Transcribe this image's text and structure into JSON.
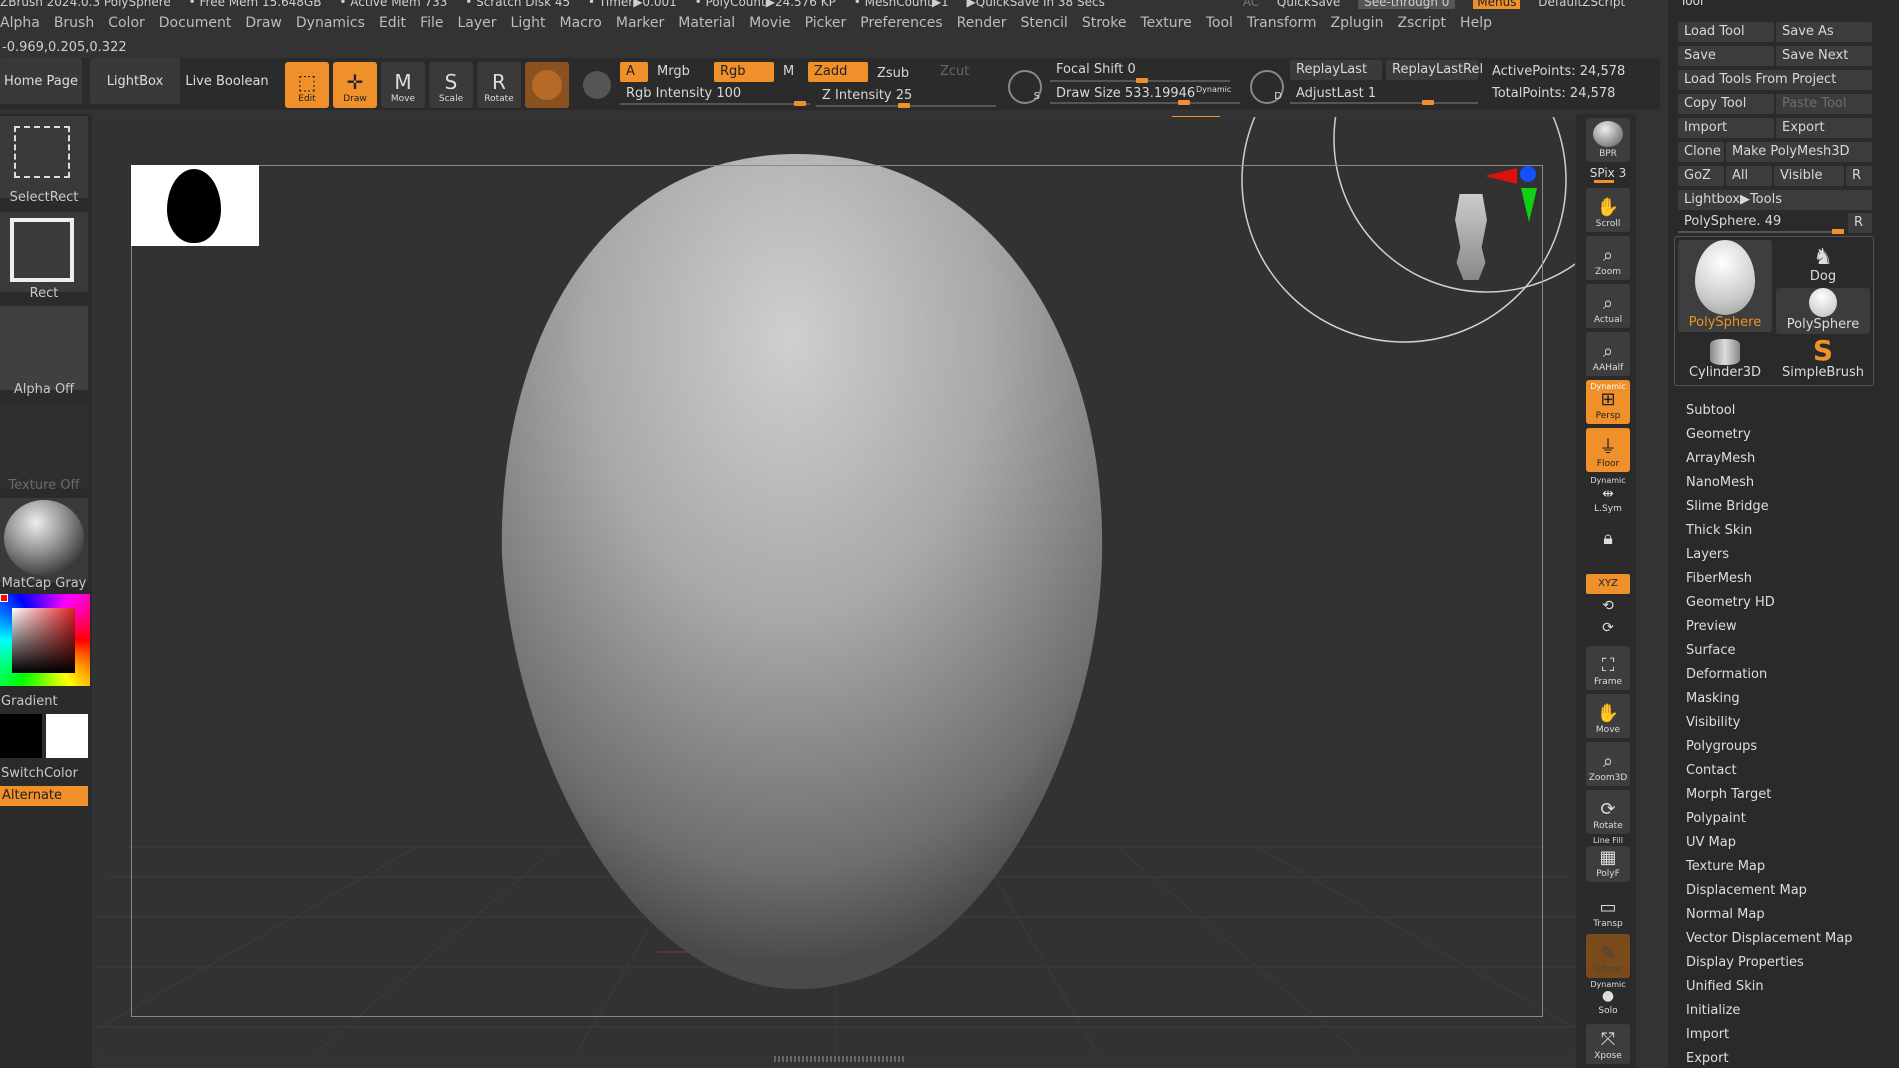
{
  "title_bar": {
    "app": "ZBrush 2024.0.3 PolySphere",
    "free_mem": "• Free Mem 15.648GB",
    "active_mem": "• Active Mem 733",
    "scratch": "• Scratch Disk 45",
    "timer": "• Timer▶0.001",
    "polycount": "• PolyCount▶24.576 KP",
    "meshcount": "• MeshCount▶1",
    "quicksave": "▶QuickSave In 38 Secs",
    "ac": "AC",
    "quicksave_btn": "QuickSave",
    "seethrough": "See-through 0",
    "menus": "Menus",
    "script": "DefaultZScript"
  },
  "menubar": [
    "Alpha",
    "Brush",
    "Color",
    "Document",
    "Draw",
    "Dynamics",
    "Edit",
    "File",
    "Layer",
    "Light",
    "Macro",
    "Marker",
    "Material",
    "Movie",
    "Picker",
    "Preferences",
    "Render",
    "Stencil",
    "Stroke",
    "Texture",
    "Tool",
    "Transform",
    "Zplugin",
    "Zscript",
    "Help"
  ],
  "coords": "-0.969,0.205,0.322",
  "shelf": {
    "home_page": "Home Page",
    "lightbox": "LightBox",
    "live_boolean": "Live Boolean",
    "edit": "Edit",
    "draw": "Draw",
    "move": "Move",
    "scale": "Scale",
    "rotate": "Rotate",
    "a": "A",
    "mrgb": "Mrgb",
    "rgb": "Rgb",
    "m": "M",
    "zadd": "Zadd",
    "zsub": "Zsub",
    "zcut": "Zcut",
    "rgb_intensity": "Rgb Intensity 100",
    "z_intensity": "Z Intensity 25",
    "focal_shift": "Focal Shift 0",
    "draw_size": "Draw Size 533.19946",
    "dynamic": "Dynamic",
    "replay_last": "ReplayLast",
    "replay_last_rel": "ReplayLastRel",
    "adjust_last": "AdjustLast 1",
    "active_points": "ActivePoints: 24,578",
    "total_points": "TotalPoints: 24,578",
    "s": "S",
    "d": "D"
  },
  "left_panel": {
    "select_rect": "SelectRect",
    "rect": "Rect",
    "alpha_off": "Alpha Off",
    "texture_off": "Texture Off",
    "matcap": "MatCap Gray",
    "gradient": "Gradient",
    "switch_color": "SwitchColor",
    "alternate": "Alternate"
  },
  "right_bar": {
    "bpr": "BPR",
    "spix": "SPix 3",
    "scroll": "Scroll",
    "zoom": "Zoom",
    "actual": "Actual",
    "aahalf": "AAHalf",
    "dynamic_persp": "Dynamic",
    "persp": "Persp",
    "floor": "Floor",
    "dynamic_lsym": "Dynamic",
    "lsym": "L.Sym",
    "xyz": "XYZ",
    "frame": "Frame",
    "move": "Move",
    "zoom3d": "Zoom3D",
    "rotate": "Rotate",
    "line_fill": "Line Fill",
    "polyf": "PolyF",
    "transp": "Transp",
    "ghost": "Ghost",
    "dynamic_solo": "Dynamic",
    "solo": "Solo",
    "xpose": "Xpose"
  },
  "tool_panel": {
    "header": "Tool",
    "load_tool": "Load Tool",
    "save_as": "Save As",
    "save": "Save",
    "save_next": "Save Next",
    "load_from_project": "Load Tools From Project",
    "copy_tool": "Copy Tool",
    "paste_tool": "Paste Tool",
    "import": "Import",
    "export": "Export",
    "clone": "Clone",
    "make_polymesh": "Make PolyMesh3D",
    "goz": "GoZ",
    "all": "All",
    "visible": "Visible",
    "r": "R",
    "lightbox_tools": "Lightbox▶Tools",
    "polysphere_slider": "PolySphere. 49",
    "thumbs": [
      "PolySphere",
      "Dog",
      "PolySphere",
      "Cylinder3D",
      "SimpleBrush"
    ],
    "sections": [
      "Subtool",
      "Geometry",
      "ArrayMesh",
      "NanoMesh",
      "Slime Bridge",
      "Thick Skin",
      "Layers",
      "FiberMesh",
      "Geometry HD",
      "Preview",
      "Surface",
      "Deformation",
      "Masking",
      "Visibility",
      "Polygroups",
      "Contact",
      "Morph Target",
      "Polypaint",
      "UV Map",
      "Texture Map",
      "Displacement Map",
      "Normal Map",
      "Vector Displacement Map",
      "Display Properties",
      "Unified Skin",
      "Initialize",
      "Import",
      "Export"
    ]
  },
  "colors": {
    "accent": "#f0902a",
    "panel": "#2b2b2b",
    "viewport": "#323232",
    "mesh": "#b9b9b9"
  }
}
